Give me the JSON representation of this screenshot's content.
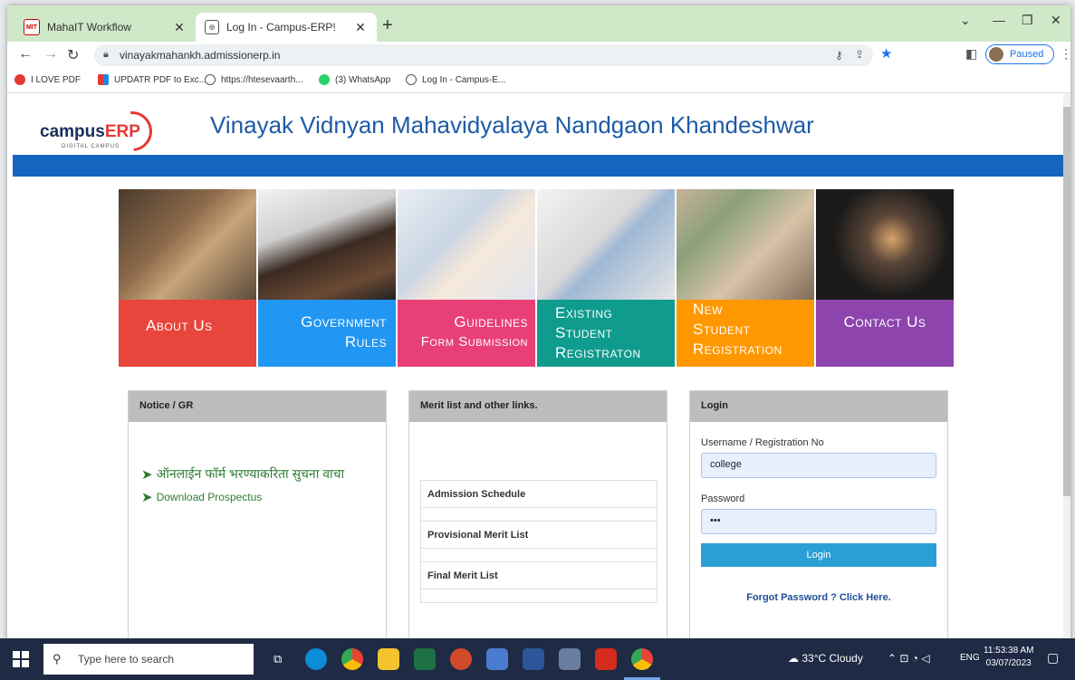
{
  "browser": {
    "tabs": [
      {
        "title": "MahaIT Workflow",
        "favicon": "mahait-icon"
      },
      {
        "title": "Log In - Campus-ERP!",
        "favicon": "globe-icon"
      }
    ],
    "new_tab": "+",
    "url": "vinayakmahankh.admissionerp.in",
    "profile_label": "Paused",
    "bookmarks": [
      "I LOVE PDF",
      "UPDATR PDF to Exc...",
      "https://htesevaarth...",
      "(3) WhatsApp",
      "Log In - Campus-E..."
    ]
  },
  "page": {
    "logo_text_1": "campus",
    "logo_text_2": "ERP",
    "logo_sub": "DIGITAL CAMPUS",
    "title": "Vinayak Vidnyan Mahavidyalaya Nandgaon Khandeshwar",
    "tiles": [
      {
        "lines": [
          "About Us"
        ],
        "color": "#e8453c",
        "align": "left"
      },
      {
        "lines": [
          "Government",
          "Rules"
        ],
        "color": "#2196f3",
        "align": "right"
      },
      {
        "lines": [
          "Guidelines",
          "Form Submission"
        ],
        "color": "#e84076",
        "align": "right"
      },
      {
        "lines": [
          "Existing",
          "Student",
          "Registraton"
        ],
        "color": "#0f9b8e",
        "align": "left"
      },
      {
        "lines": [
          "New",
          "Student",
          "Registration"
        ],
        "color": "#ff9800",
        "align": "left"
      },
      {
        "lines": [
          "Contact Us"
        ],
        "color": "#8e44ad",
        "align": "center"
      }
    ],
    "notice": {
      "heading": "Notice / GR",
      "links": [
        "ऑनलाईन फॉर्म भरण्याकरिता सुचना वाचा",
        "Download Prospectus"
      ]
    },
    "merit": {
      "heading": "Merit list and other links.",
      "items": [
        "Admission Schedule",
        "Provisional Merit List",
        "Final Merit List"
      ]
    },
    "login": {
      "heading": "Login",
      "username_label": "Username / Registration No",
      "username_value": "college",
      "password_label": "Password",
      "password_value": "•••",
      "button": "Login",
      "forgot": "Forgot Password ? Click Here."
    }
  },
  "taskbar": {
    "search_placeholder": "Type here to search",
    "weather": "33°C  Cloudy",
    "lang": "ENG",
    "time": "11:53:38 AM",
    "date": "03/07/2023"
  }
}
